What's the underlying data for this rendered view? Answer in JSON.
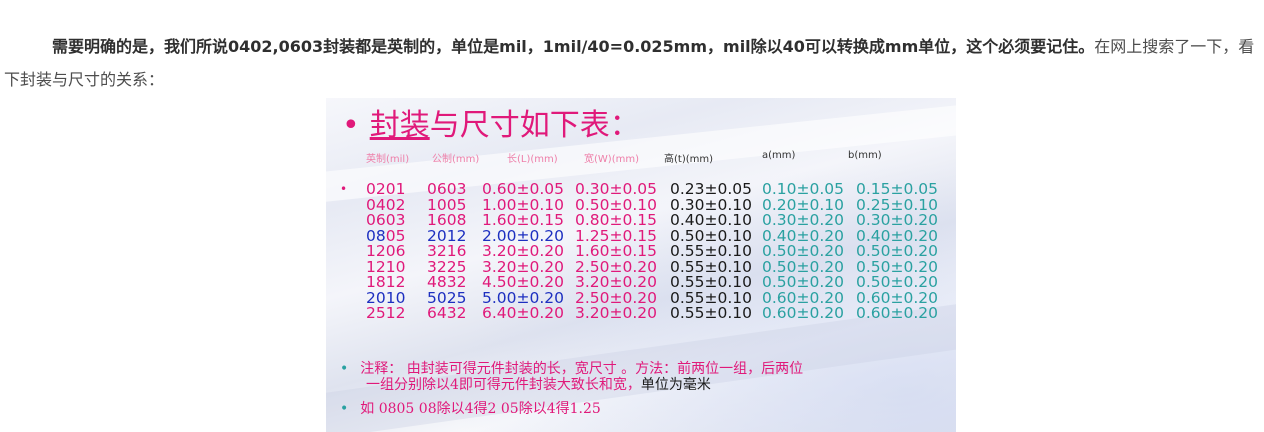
{
  "paragraph": {
    "bold_text": "需要明确的是，我们所说0402,0603封装都是英制的，单位是mil，1mil/40=0.025mm，mil除以40可以转换成mm单位，这个必须要记住。",
    "normal_text": "在网上搜索了一下，看下封装与尺寸的关系："
  },
  "slide": {
    "title_bullet": "•",
    "title_underlined": "封装",
    "title_rest": "与尺寸如下表：",
    "headers": [
      "英制(mil)",
      "公制(mm)",
      "长(L)(mm)",
      "宽(W)(mm)",
      "高(t)(mm)",
      "a(mm)",
      "b(mm)"
    ],
    "row_bullet": "•",
    "rows": [
      [
        "0201",
        "0603",
        "0.60±0.05",
        "0.30±0.05",
        "0.23±0.05",
        "0.10±0.05",
        "0.15±0.05"
      ],
      [
        "0402",
        "1005",
        "1.00±0.10",
        "0.50±0.10",
        "0.30±0.10",
        "0.20±0.10",
        "0.25±0.10"
      ],
      [
        "0603",
        "1608",
        "1.60±0.15",
        "0.80±0.15",
        "0.40±0.10",
        "0.30±0.20",
        "0.30±0.20"
      ],
      [
        "0805",
        "2012",
        "2.00±0.20",
        "1.25±0.15",
        "0.50±0.10",
        "0.40±0.20",
        "0.40±0.20"
      ],
      [
        "1206",
        "3216",
        "3.20±0.20",
        "1.60±0.15",
        "0.55±0.10",
        "0.50±0.20",
        "0.50±0.20"
      ],
      [
        "1210",
        "3225",
        "3.20±0.20",
        "2.50±0.20",
        "0.55±0.10",
        "0.50±0.20",
        "0.50±0.20"
      ],
      [
        "1812",
        "4832",
        "4.50±0.20",
        "3.20±0.20",
        "0.55±0.10",
        "0.50±0.20",
        "0.50±0.20"
      ],
      [
        "2010",
        "5025",
        "5.00±0.20",
        "2.50±0.20",
        "0.55±0.10",
        "0.60±0.20",
        "0.60±0.20"
      ],
      [
        "2512",
        "6432",
        "6.40±0.20",
        "3.20±0.20",
        "0.55±0.10",
        "0.60±0.20",
        "0.60±0.20"
      ]
    ],
    "note_bullet": "•",
    "note_line1": "注释： 由封装可得元件封装的长，宽尺寸 。方法：前两位一组，后两位",
    "note_line2_pink": "一组分别除以4即可得元件封装大致长和宽，",
    "note_line2_dark": "单位为毫米",
    "example_bullet": "•",
    "example_text": "如   0805 08除以4得2  05除以4得1.25",
    "colors": {
      "pink": "#e0197a",
      "blue": "#1d2fc0",
      "teal": "#2aa1a1",
      "black": "#1a1a1a",
      "header_pink": "#ee7fa9",
      "header_dark": "#333333"
    }
  }
}
